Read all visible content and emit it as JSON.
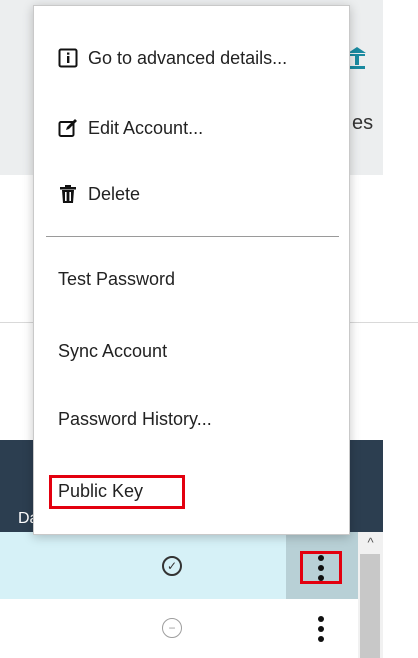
{
  "background": {
    "header_text": "es",
    "table_header_text": "Da"
  },
  "menu": {
    "items": [
      {
        "label": "Go to advanced details...",
        "icon": "info-icon"
      },
      {
        "label": "Edit Account...",
        "icon": "edit-icon"
      },
      {
        "label": "Delete",
        "icon": "trash-icon"
      },
      {
        "label": "Test Password",
        "icon": null
      },
      {
        "label": "Sync Account",
        "icon": null
      },
      {
        "label": "Password History...",
        "icon": null
      },
      {
        "label": "Public Key",
        "icon": null,
        "highlighted": true
      }
    ]
  },
  "rows": [
    {
      "status": "check-circle-icon",
      "selected": true
    },
    {
      "status": "minus-circle-icon",
      "selected": false
    }
  ],
  "colors": {
    "accent": "#e3000f",
    "row_selected": "#d6f1f7",
    "header_dark": "#2c3e50",
    "icon_teal": "#1a8aa0"
  }
}
